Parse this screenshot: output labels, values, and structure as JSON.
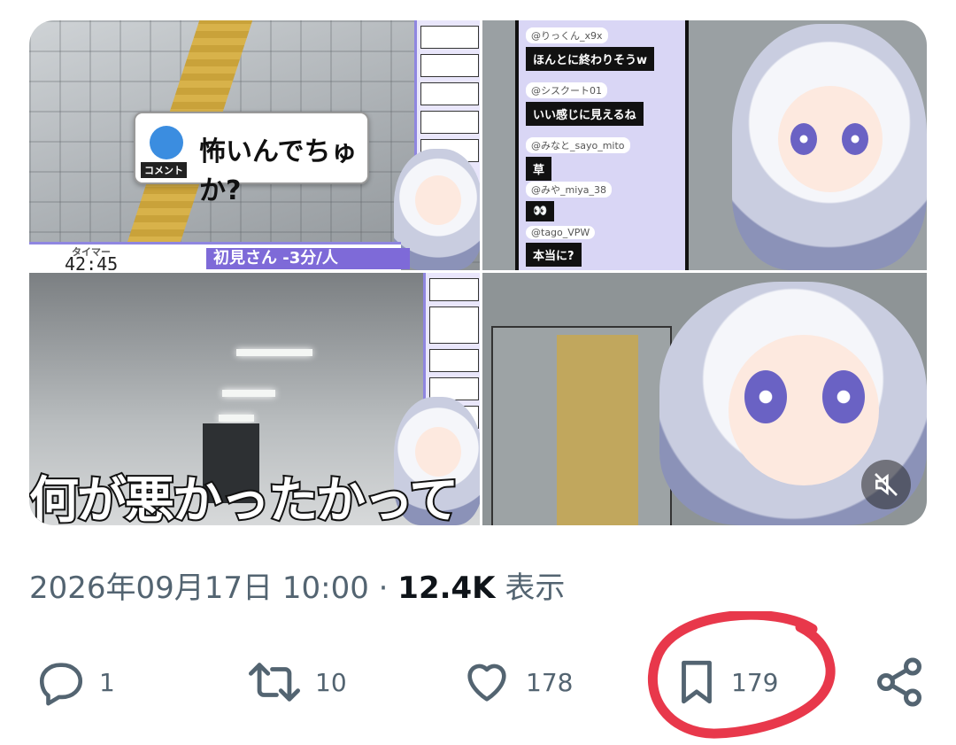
{
  "media": {
    "tile1": {
      "comment_label": "コメント",
      "comment_text": "怖いんでちゅか?",
      "timer_label": "タイマー",
      "timer_value": "42:45",
      "status_text": "初見さん -3分/人"
    },
    "tile2": {
      "chat": [
        {
          "user": "@りっくん_x9x",
          "text": "ほんとに終わりそうw"
        },
        {
          "user": "@シスクート01",
          "text": "いい感じに見えるね"
        },
        {
          "user": "@みなと_sayo_mito",
          "text": "草"
        },
        {
          "user": "@みや_miya_38",
          "text": "👀"
        },
        {
          "user": "@tago_VPW",
          "text": "本当に?"
        }
      ]
    },
    "tile3": {
      "caption": "何が悪かったかって"
    },
    "tile4": {
      "mute_icon": "speaker-muted-icon"
    }
  },
  "meta": {
    "datetime": "2026年09月17日 10:00",
    "separator": "·",
    "views_count": "12.4K",
    "views_label": "表示"
  },
  "actions": {
    "reply_count": "1",
    "repost_count": "10",
    "like_count": "178",
    "bookmark_count": "179"
  },
  "annotation": {
    "color": "#e8384b"
  }
}
